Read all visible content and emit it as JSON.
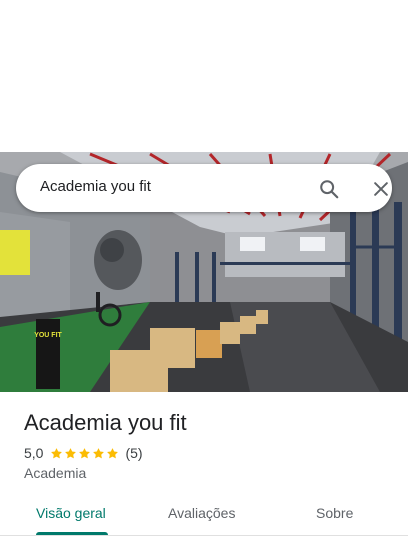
{
  "search": {
    "query": "Academia you fit",
    "search_icon": "search-icon",
    "close_icon": "close-icon"
  },
  "hero": {
    "photo": "gym-interior-photo",
    "sign_text": "YOU FIT"
  },
  "place": {
    "name": "Academia you fit",
    "rating": "5,0",
    "stars": 5,
    "review_count": "(5)",
    "category": "Academia"
  },
  "tabs": [
    {
      "label": "Visão geral",
      "active": true
    },
    {
      "label": "Avaliações",
      "active": false
    },
    {
      "label": "Sobre",
      "active": false
    }
  ],
  "colors": {
    "accent": "#00796b",
    "star": "#fbbc04",
    "text_primary": "#202124",
    "text_secondary": "#5f6368"
  }
}
